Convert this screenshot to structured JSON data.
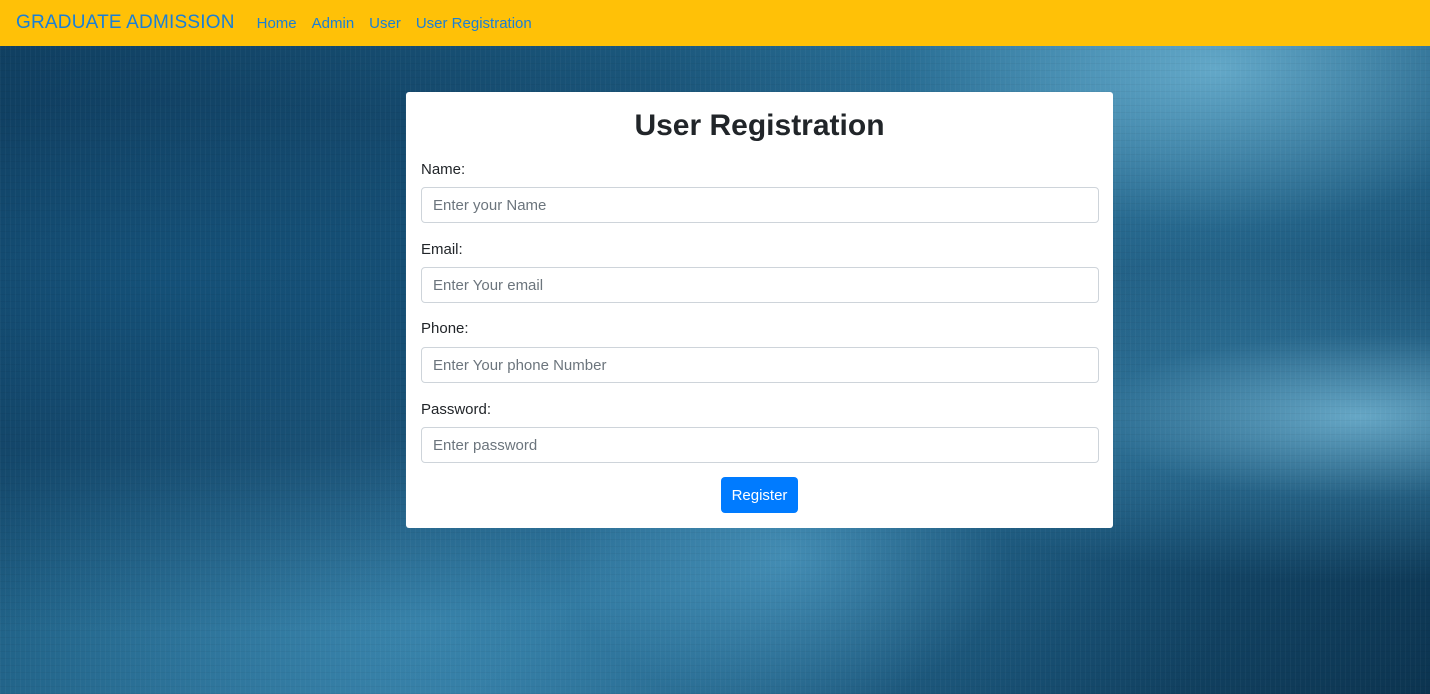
{
  "navbar": {
    "brand": "GRADUATE ADMISSION",
    "links": [
      "Home",
      "Admin",
      "User",
      "User Registration"
    ],
    "background_color": "#ffc107",
    "link_color": "#1a7fd6"
  },
  "form": {
    "title": "User Registration",
    "fields": [
      {
        "label": "Name:",
        "placeholder": "Enter your Name",
        "value": ""
      },
      {
        "label": "Email:",
        "placeholder": "Enter Your email",
        "value": ""
      },
      {
        "label": "Phone:",
        "placeholder": "Enter Your phone Number",
        "value": ""
      },
      {
        "label": "Password:",
        "placeholder": "Enter password",
        "value": ""
      }
    ],
    "submit_label": "Register",
    "submit_color": "#007bff"
  }
}
